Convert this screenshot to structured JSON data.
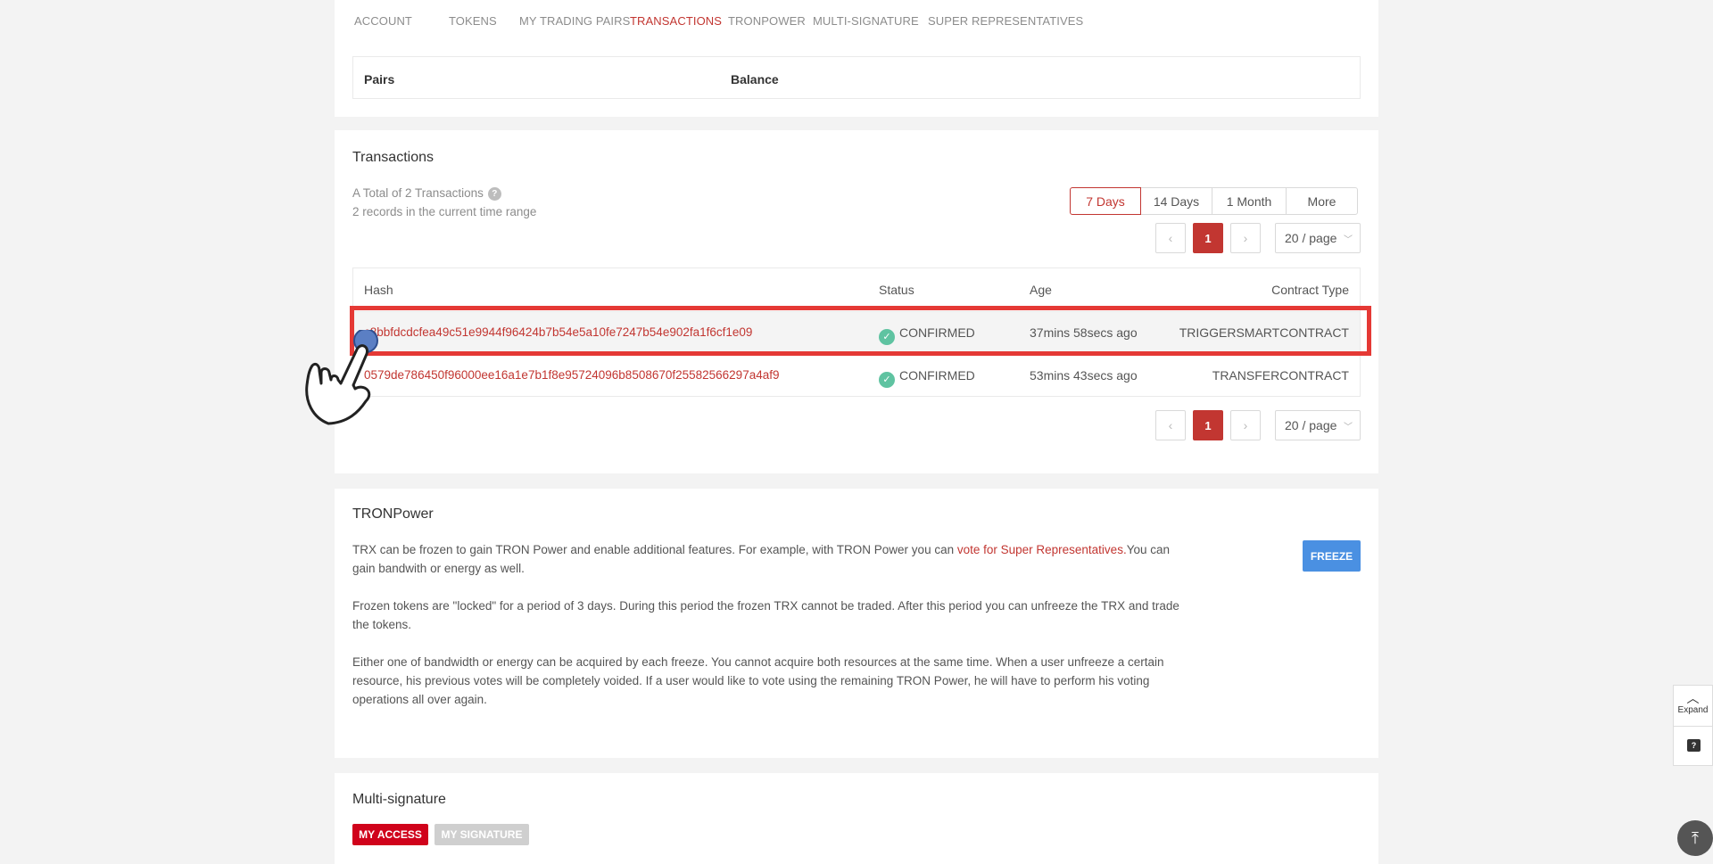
{
  "nav": {
    "tabs": [
      "ACCOUNT",
      "TOKENS",
      "MY TRADING PAIRS",
      "TRANSACTIONS",
      "TRONPOWER",
      "MULTI-SIGNATURE",
      "SUPER REPRESENTATIVES"
    ],
    "active": "TRANSACTIONS"
  },
  "pairs": {
    "col_pairs": "Pairs",
    "col_balance": "Balance"
  },
  "transactions": {
    "title": "Transactions",
    "total": "A Total of 2 Transactions",
    "help": "?",
    "range_note": "2 records in the current time range",
    "ranges": [
      "7 Days",
      "14 Days",
      "1 Month",
      "More"
    ],
    "active_range": "7 Days",
    "pager": {
      "prev": "‹",
      "current": "1",
      "next": "›",
      "size": "20 / page"
    },
    "columns": {
      "hash": "Hash",
      "status": "Status",
      "age": "Age",
      "type": "Contract Type"
    },
    "rows": [
      {
        "hash": "c8bbfdcdcfea49c51e9944f96424b7b54e5a10fe7247b54e902fa1f6cf1e09",
        "status": "CONFIRMED",
        "age": "37mins 58secs ago",
        "type": "TRIGGERSMARTCONTRACT"
      },
      {
        "hash": "0579de786450f96000ee16a1e7b1f8e95724096b8508670f25582566297a4af9",
        "status": "CONFIRMED",
        "age": "53mins 43secs ago",
        "type": "TRANSFERCONTRACT"
      }
    ]
  },
  "tronpower": {
    "title": "TRONPower",
    "p1_a": "TRX can be frozen to gain TRON Power and enable additional features. For example, with TRON Power you can ",
    "p1_link": "vote for Super Representatives.",
    "p1_b": "You can gain bandwith or energy as well.",
    "p2": "Frozen tokens are \"locked\" for a period of 3 days. During this period the frozen TRX cannot be traded. After this period you can unfreeze the TRX and trade the tokens.",
    "p3": "Either one of bandwidth or energy can be acquired by each freeze. You cannot acquire both resources at the same time. When a user unfreeze a certain resource, his previous votes will be completely voided. If a user would like to vote using the remaining TRON Power, he will have to perform his voting operations all over again.",
    "freeze_label": "FREEZE"
  },
  "multisig": {
    "title": "Multi-signature",
    "my_access": "MY ACCESS",
    "my_signature": "MY SIGNATURE"
  },
  "side": {
    "expand_label": "Expand",
    "question_icon": "?"
  },
  "colors": {
    "accent": "#c23631",
    "freeze": "#4a90e2",
    "confirmed": "#5fc3a1",
    "highlight": "#e53935"
  }
}
